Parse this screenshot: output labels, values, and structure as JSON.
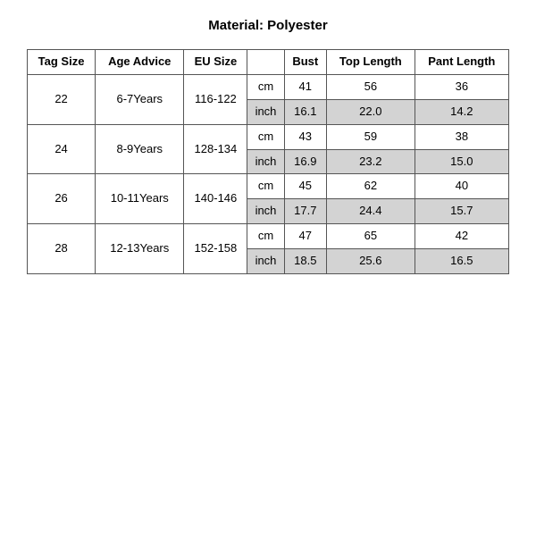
{
  "title": "Material: Polyester",
  "headers": {
    "tagSize": "Tag Size",
    "ageAdvice": "Age Advice",
    "euSize": "EU Size",
    "unit": "",
    "bust": "Bust",
    "topLength": "Top Length",
    "pantLength": "Pant Length"
  },
  "rows": [
    {
      "tagSize": "22",
      "ageAdvice": "6-7Years",
      "euSize": "116-122",
      "cm": {
        "unit": "cm",
        "bust": "41",
        "topLength": "56",
        "pantLength": "36"
      },
      "inch": {
        "unit": "inch",
        "bust": "16.1",
        "topLength": "22.0",
        "pantLength": "14.2"
      }
    },
    {
      "tagSize": "24",
      "ageAdvice": "8-9Years",
      "euSize": "128-134",
      "cm": {
        "unit": "cm",
        "bust": "43",
        "topLength": "59",
        "pantLength": "38"
      },
      "inch": {
        "unit": "inch",
        "bust": "16.9",
        "topLength": "23.2",
        "pantLength": "15.0"
      }
    },
    {
      "tagSize": "26",
      "ageAdvice": "10-11Years",
      "euSize": "140-146",
      "cm": {
        "unit": "cm",
        "bust": "45",
        "topLength": "62",
        "pantLength": "40"
      },
      "inch": {
        "unit": "inch",
        "bust": "17.7",
        "topLength": "24.4",
        "pantLength": "15.7"
      }
    },
    {
      "tagSize": "28",
      "ageAdvice": "12-13Years",
      "euSize": "152-158",
      "cm": {
        "unit": "cm",
        "bust": "47",
        "topLength": "65",
        "pantLength": "42"
      },
      "inch": {
        "unit": "inch",
        "bust": "18.5",
        "topLength": "25.6",
        "pantLength": "16.5"
      }
    }
  ]
}
